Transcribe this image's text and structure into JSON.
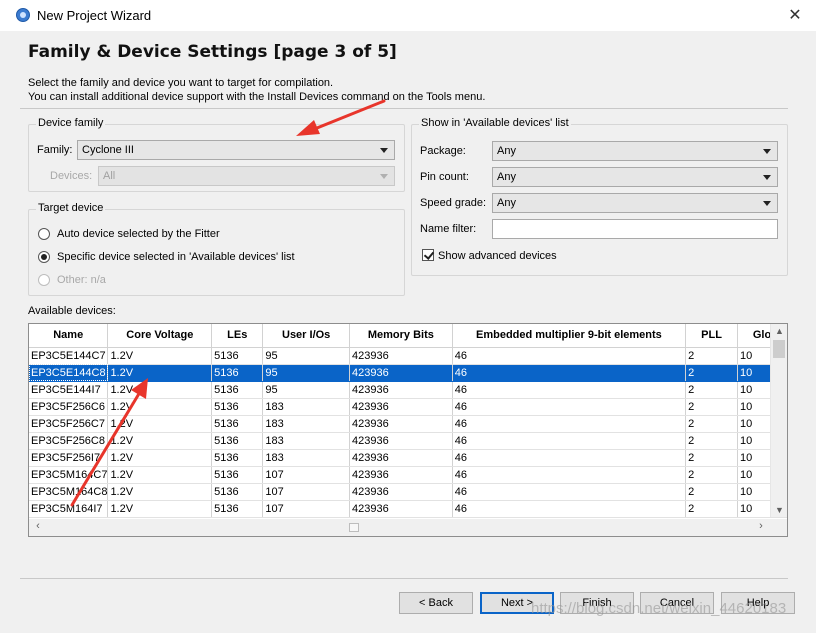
{
  "window": {
    "title": "New Project Wizard",
    "close_glyph": "✕"
  },
  "heading": "Family & Device Settings [page 3 of 5]",
  "description": [
    "Select the family and device you want to target for compilation.",
    "You can install additional device support with the Install Devices command on the Tools menu."
  ],
  "device_family": {
    "group_title": "Device family",
    "family_label": "Family:",
    "family_value": "Cyclone III",
    "devices_label": "Devices:",
    "devices_value": "All"
  },
  "target_device": {
    "group_title": "Target device",
    "options": [
      {
        "label": "Auto device selected by the Fitter",
        "selected": false,
        "enabled": true
      },
      {
        "label": "Specific device selected in 'Available devices' list",
        "selected": true,
        "enabled": true
      },
      {
        "label": "Other:  n/a",
        "selected": false,
        "enabled": false
      }
    ]
  },
  "show_available": {
    "group_title": "Show in 'Available devices' list",
    "package_label": "Package:",
    "package_value": "Any",
    "pin_count_label": "Pin count:",
    "pin_count_value": "Any",
    "speed_grade_label": "Speed grade:",
    "speed_grade_value": "Any",
    "name_filter_label": "Name filter:",
    "name_filter_value": "",
    "show_advanced_label": "Show advanced devices",
    "show_advanced_checked": true
  },
  "available_devices": {
    "label": "Available devices:",
    "columns": [
      "Name",
      "Core Voltage",
      "LEs",
      "User I/Os",
      "Memory Bits",
      "Embedded multiplier 9-bit elements",
      "PLL",
      "Glo"
    ],
    "rows": [
      [
        "EP3C5E144C7",
        "1.2V",
        "5136",
        "95",
        "423936",
        "46",
        "2",
        "10"
      ],
      [
        "EP3C5E144C8",
        "1.2V",
        "5136",
        "95",
        "423936",
        "46",
        "2",
        "10"
      ],
      [
        "EP3C5E144I7",
        "1.2V",
        "5136",
        "95",
        "423936",
        "46",
        "2",
        "10"
      ],
      [
        "EP3C5F256C6",
        "1.2V",
        "5136",
        "183",
        "423936",
        "46",
        "2",
        "10"
      ],
      [
        "EP3C5F256C7",
        "1.2V",
        "5136",
        "183",
        "423936",
        "46",
        "2",
        "10"
      ],
      [
        "EP3C5F256C8",
        "1.2V",
        "5136",
        "183",
        "423936",
        "46",
        "2",
        "10"
      ],
      [
        "EP3C5F256I7",
        "1.2V",
        "5136",
        "183",
        "423936",
        "46",
        "2",
        "10"
      ],
      [
        "EP3C5M164C7",
        "1.2V",
        "5136",
        "107",
        "423936",
        "46",
        "2",
        "10"
      ],
      [
        "EP3C5M164C8",
        "1.2V",
        "5136",
        "107",
        "423936",
        "46",
        "2",
        "10"
      ],
      [
        "EP3C5M164I7",
        "1.2V",
        "5136",
        "107",
        "423936",
        "46",
        "2",
        "10"
      ]
    ],
    "selected_row": 1
  },
  "buttons": {
    "back": "< Back",
    "next": "Next >",
    "finish": "Finish",
    "cancel": "Cancel",
    "help": "Help"
  },
  "watermark": "https://blog.csdn.net/weixin_44620183",
  "colors": {
    "selection": "#0a64c8",
    "annotation_arrow": "#e8352b"
  }
}
